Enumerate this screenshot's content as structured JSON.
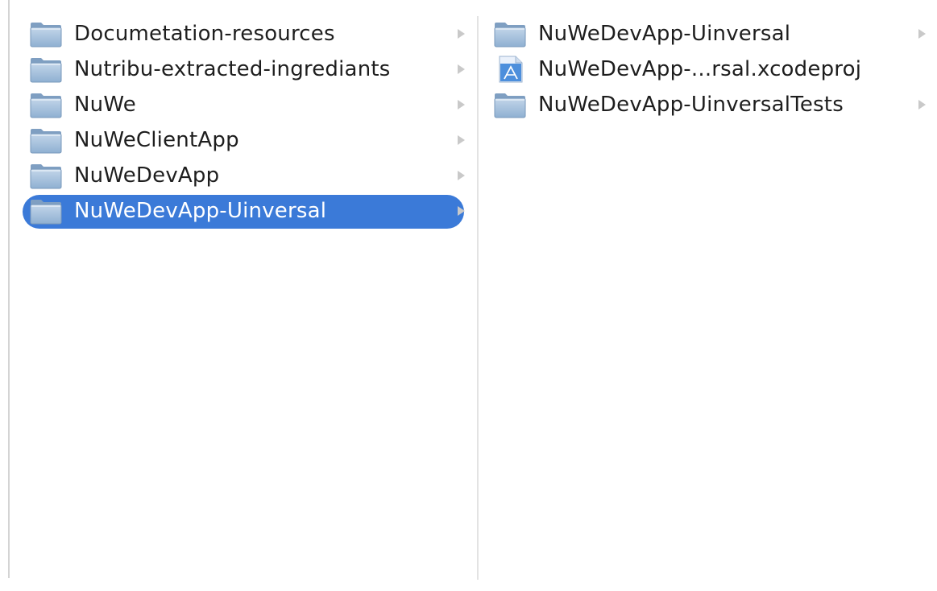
{
  "column1": {
    "items": [
      {
        "label": "Documetation-resources",
        "icon": "folder-icon",
        "has_children": true,
        "selected": false
      },
      {
        "label": "Nutribu-extracted-ingrediants",
        "icon": "folder-icon",
        "has_children": true,
        "selected": false
      },
      {
        "label": "NuWe",
        "icon": "folder-icon",
        "has_children": true,
        "selected": false
      },
      {
        "label": "NuWeClientApp",
        "icon": "folder-icon",
        "has_children": true,
        "selected": false
      },
      {
        "label": "NuWeDevApp",
        "icon": "folder-icon",
        "has_children": true,
        "selected": false
      },
      {
        "label": "NuWeDevApp-Uinversal",
        "icon": "folder-icon",
        "has_children": true,
        "selected": true
      }
    ]
  },
  "column2": {
    "items": [
      {
        "label": "NuWeDevApp-Uinversal",
        "icon": "folder-icon",
        "has_children": true,
        "selected": false
      },
      {
        "label": "NuWeDevApp-...rsal.xcodeproj",
        "icon": "xcodeproj-file-icon",
        "has_children": false,
        "selected": false
      },
      {
        "label": "NuWeDevApp-UinversalTests",
        "icon": "folder-icon",
        "has_children": true,
        "selected": false
      }
    ]
  },
  "colors": {
    "selection": "#3b7ad8",
    "folder": "#a9c4de",
    "text": "#1e1e1e",
    "selected_text": "#ffffff"
  }
}
